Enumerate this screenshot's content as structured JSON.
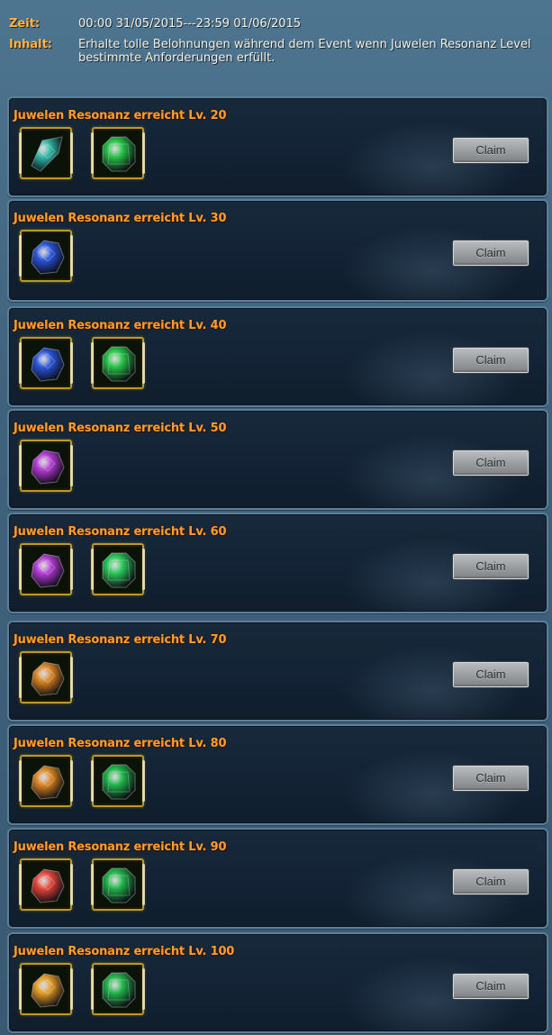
{
  "header": {
    "time_label": "Zeit:",
    "time_value": "00:00 31/05/2015---23:59 01/06/2015",
    "content_label": "Inhalt:",
    "content_value": "Erhalte tolle Belohnungen während dem Event wenn Juwelen Resonanz Level bestimmte Anforderungen erfüllt."
  },
  "claim_label": "Claim",
  "rewards": [
    {
      "title": "Juwelen Resonanz erreicht Lv. 20",
      "items": [
        {
          "icon": "teal-crystal-icon",
          "color": "#31b8a6"
        },
        {
          "icon": "green-gem-icon",
          "color": "#27c347"
        }
      ]
    },
    {
      "title": "Juwelen Resonanz erreicht Lv. 30",
      "items": [
        {
          "icon": "blue-gem-icon",
          "color": "#2b55d8"
        }
      ]
    },
    {
      "title": "Juwelen Resonanz erreicht Lv. 40",
      "items": [
        {
          "icon": "blue-gem-icon",
          "color": "#2b55d8"
        },
        {
          "icon": "green-gem-icon",
          "color": "#27c347"
        }
      ]
    },
    {
      "title": "Juwelen Resonanz erreicht Lv. 50",
      "items": [
        {
          "icon": "purple-gem-icon",
          "color": "#b13bd2"
        }
      ]
    },
    {
      "title": "Juwelen Resonanz erreicht Lv. 60",
      "items": [
        {
          "icon": "purple-gem-icon",
          "color": "#b13bd2"
        },
        {
          "icon": "green-gem-icon",
          "color": "#2bc85a"
        }
      ]
    },
    {
      "title": "Juwelen Resonanz erreicht Lv. 70",
      "items": [
        {
          "icon": "orange-gem-icon",
          "color": "#d98522"
        }
      ]
    },
    {
      "title": "Juwelen Resonanz erreicht Lv. 80",
      "items": [
        {
          "icon": "orange-gem-icon",
          "color": "#d98522"
        },
        {
          "icon": "green-gem-icon",
          "color": "#20b64a"
        }
      ]
    },
    {
      "title": "Juwelen Resonanz erreicht Lv. 90",
      "items": [
        {
          "icon": "red-gem-icon",
          "color": "#e2453a"
        },
        {
          "icon": "green-gem-icon",
          "color": "#22b54a"
        }
      ]
    },
    {
      "title": "Juwelen Resonanz erreicht Lv. 100",
      "items": [
        {
          "icon": "orange-gem-icon",
          "color": "#e19a25"
        },
        {
          "icon": "green-gem-icon",
          "color": "#22b54a"
        }
      ]
    }
  ]
}
